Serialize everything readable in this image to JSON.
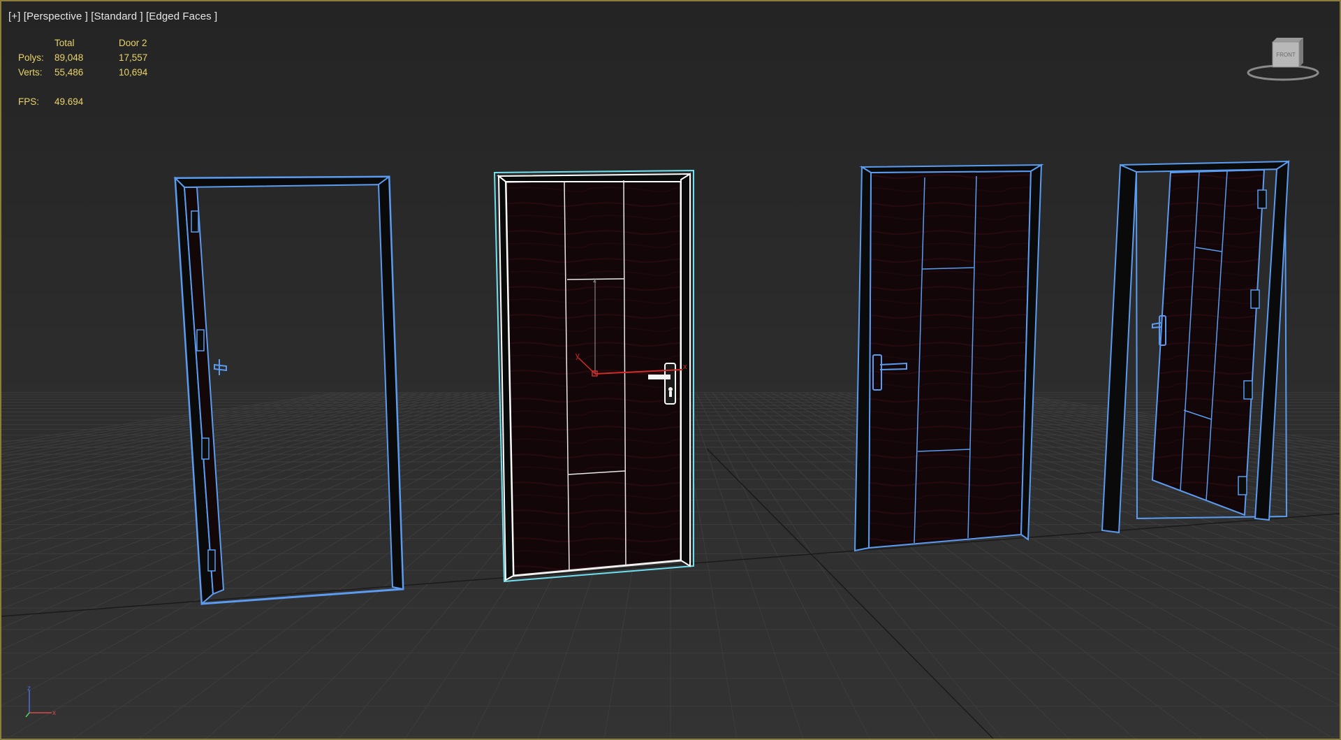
{
  "viewport": {
    "label_plus": "[+]",
    "label_view": "[Perspective ]",
    "label_shading": "[Standard ]",
    "label_edges": "[Edged Faces ]",
    "frame_color": "#8c7f3e",
    "background_color": "#2b2b2b"
  },
  "stats": {
    "col_total": "Total",
    "col_selected": "Door 2",
    "polys_label": "Polys:",
    "polys_total": "89,048",
    "polys_selected": "17,557",
    "verts_label": "Verts:",
    "verts_total": "55,486",
    "verts_selected": "10,694",
    "fps_label": "FPS:",
    "fps_value": "49.694",
    "text_color": "#e8d46a"
  },
  "viewcube": {
    "face_label": "FRONT",
    "icon": "viewcube-icon"
  },
  "axis_tripod": {
    "z_label": "z",
    "x_label": "x",
    "icon": "axis-tripod-icon"
  },
  "scene": {
    "objects": [
      "door-1",
      "door-2",
      "door-3",
      "door-4"
    ],
    "selected_object": "door-2",
    "wire_color": "#5b9cf0",
    "selected_highlight_color": "#6fe0f0",
    "door_panel_color": "#120608"
  }
}
